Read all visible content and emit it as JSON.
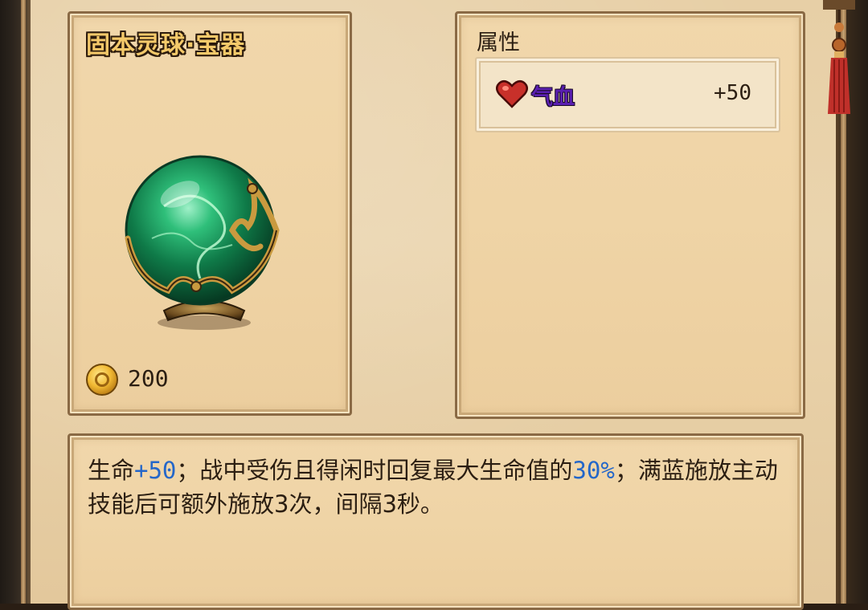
{
  "item": {
    "title": "固本灵球·宝器",
    "price": "200",
    "price_icon": "gold-coin-icon",
    "image": "jade-orb"
  },
  "attributes": {
    "label": "属性",
    "rows": [
      {
        "icon": "heart-icon",
        "name": "气血",
        "value": "+50"
      }
    ]
  },
  "description": {
    "segments": [
      {
        "text": "生命",
        "highlight": false
      },
      {
        "text": "+50",
        "highlight": true
      },
      {
        "text": "；战中受伤且得闲时回复最大生命值的",
        "highlight": false
      },
      {
        "text": "30%",
        "highlight": true
      },
      {
        "text": "；满蓝施放主动技能后可额外施放3次，间隔3秒。",
        "highlight": false
      }
    ]
  },
  "colors": {
    "title_gold": "#f4c96a",
    "attr_purple": "#5a1fb0",
    "highlight_blue": "#2467c9",
    "parchment": "#efd4a6"
  }
}
